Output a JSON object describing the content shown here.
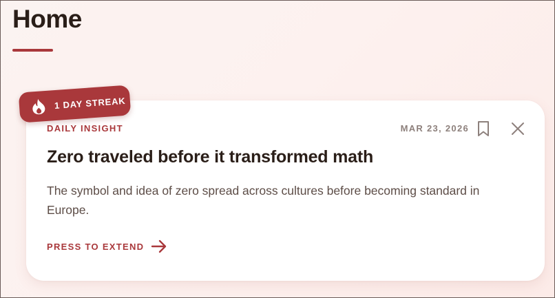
{
  "page": {
    "title": "Home"
  },
  "streak": {
    "label": "1 DAY STREAK",
    "icon": "flame-icon"
  },
  "card": {
    "category": "DAILY INSIGHT",
    "date": "MAR 23, 2026",
    "title": "Zero traveled before it transformed math",
    "body": "The symbol and idea of zero spread across cultures before becoming standard in Europe.",
    "extend_label": "PRESS TO EXTEND",
    "icons": {
      "bookmark": "bookmark-icon",
      "close": "close-icon",
      "arrow": "arrow-right-icon"
    }
  },
  "colors": {
    "accent": "#a9383b",
    "title_text": "#2a1e18",
    "body_text": "#5d4d47",
    "muted_text": "#8d807c",
    "background": "#fdf1ef",
    "card": "#ffffff"
  }
}
